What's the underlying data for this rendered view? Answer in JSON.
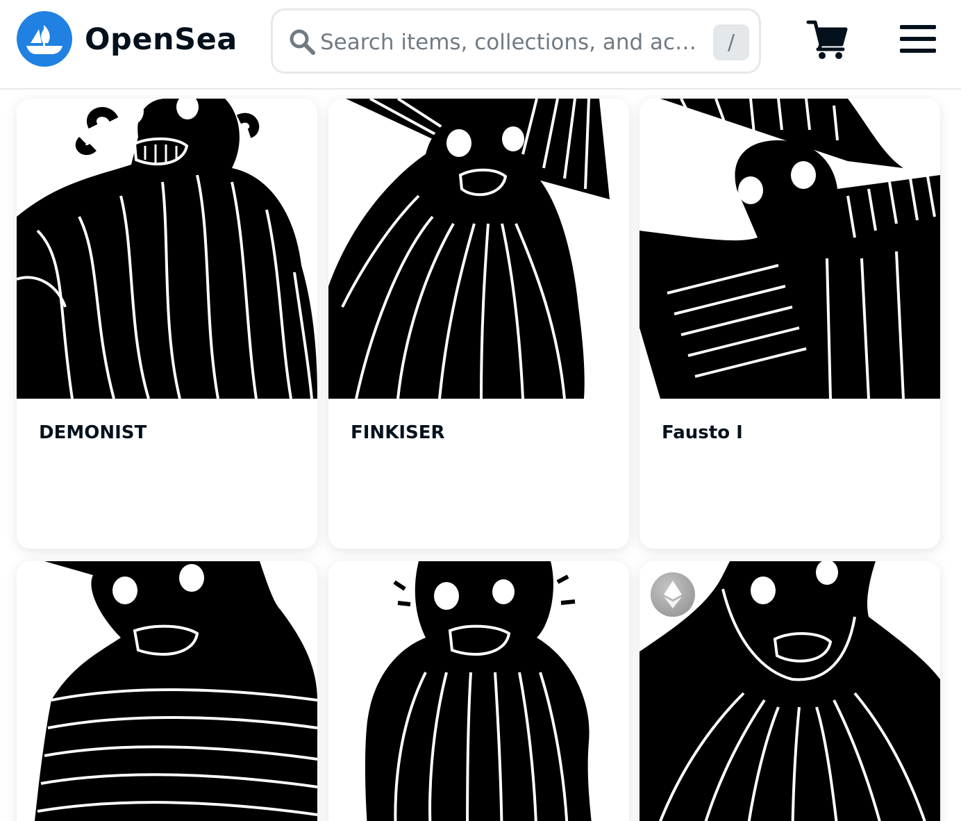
{
  "app": {
    "brand": "OpenSea"
  },
  "search": {
    "placeholder": "Search items, collections, and ac…",
    "shortcut": "/"
  },
  "colors": {
    "brand_blue": "#2081e2",
    "text": "#04111d",
    "muted": "#707a83",
    "border": "#e5e8eb"
  },
  "icons": {
    "logo": "opensea-logo-icon",
    "search": "search-icon",
    "cart": "cart-icon",
    "menu": "hamburger-menu-icon",
    "chain": "ethereum-icon"
  },
  "cards": [
    {
      "title": "DEMONIST"
    },
    {
      "title": "FINKISER"
    },
    {
      "title": "Fausto I"
    },
    {
      "title": ""
    },
    {
      "title": ""
    },
    {
      "title": "",
      "chain_badge": "ethereum"
    }
  ]
}
